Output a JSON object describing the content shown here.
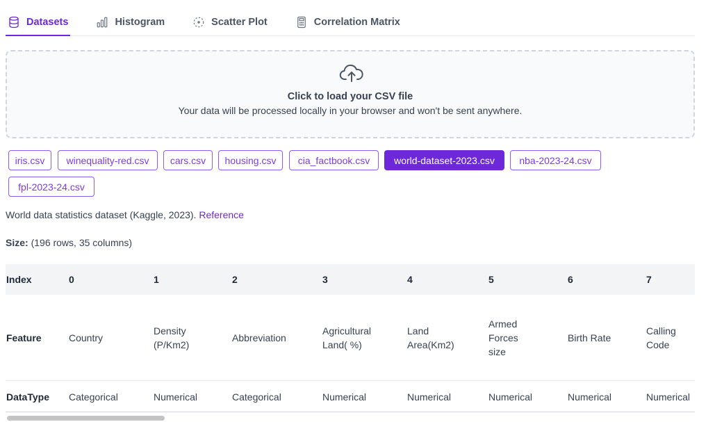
{
  "tabs": [
    {
      "label": "Datasets",
      "icon": "database-icon",
      "active": true
    },
    {
      "label": "Histogram",
      "icon": "bar-chart-icon",
      "active": false
    },
    {
      "label": "Scatter Plot",
      "icon": "scatter-icon",
      "active": false
    },
    {
      "label": "Correlation Matrix",
      "icon": "calculator-icon",
      "active": false
    }
  ],
  "upload": {
    "icon": "cloud-upload-icon",
    "title": "Click to load your CSV file",
    "subtitle": "Your data will be processed locally in your browser and won't be sent anywhere."
  },
  "datasets": [
    {
      "label": "iris.csv",
      "active": false
    },
    {
      "label": "winequality-red.csv",
      "active": false
    },
    {
      "label": "cars.csv",
      "active": false
    },
    {
      "label": "housing.csv",
      "active": false
    },
    {
      "label": "cia_factbook.csv",
      "active": false
    },
    {
      "label": "world-dataset-2023.csv",
      "active": true
    },
    {
      "label": "nba-2023-24.csv",
      "active": false
    },
    {
      "label": "fpl-2023-24.csv",
      "active": false
    }
  ],
  "description": {
    "text": "World data statistics dataset (Kaggle, 2023).",
    "link": "Reference"
  },
  "size": {
    "label": "Size:",
    "value": "(196 rows, 35 columns)"
  },
  "table": {
    "row_headers": [
      "Index",
      "Feature",
      "DataType"
    ],
    "columns": [
      {
        "index": "0",
        "feature": [
          "Country"
        ],
        "dtype": "Categorical"
      },
      {
        "index": "1",
        "feature": [
          "Density",
          "(P/Km2)"
        ],
        "dtype": "Numerical"
      },
      {
        "index": "2",
        "feature": [
          "Abbreviation"
        ],
        "dtype": "Categorical"
      },
      {
        "index": "3",
        "feature": [
          "Agricultural",
          "Land( %)"
        ],
        "dtype": "Numerical"
      },
      {
        "index": "4",
        "feature": [
          "Land",
          "Area(Km2)"
        ],
        "dtype": "Numerical"
      },
      {
        "index": "5",
        "feature": [
          "Armed",
          "Forces",
          "size"
        ],
        "dtype": "Numerical"
      },
      {
        "index": "6",
        "feature": [
          "Birth Rate"
        ],
        "dtype": "Numerical"
      },
      {
        "index": "7",
        "feature": [
          "Calling",
          "Code"
        ],
        "dtype": "Numerical"
      }
    ]
  },
  "colors": {
    "accent": "#6d28d9",
    "chip_border": "#8b5cf6"
  }
}
